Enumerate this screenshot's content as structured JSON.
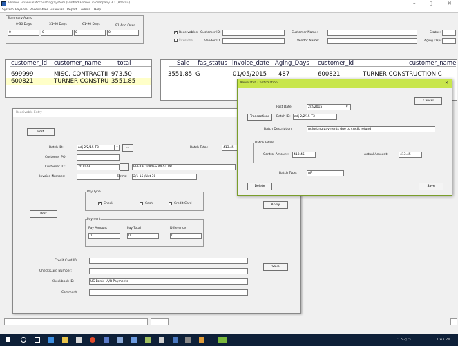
{
  "window": {
    "title": "Elinbox Financial Accounting System (Elinbad Entries in company 3.1 (Azerdi))",
    "minimize_label": "–",
    "maximize_label": "▯",
    "close_label": "✕"
  },
  "menu": [
    "System",
    "Payable",
    "Receivables",
    "Financial",
    "Report",
    "Admin",
    "Help"
  ],
  "summary_aging": {
    "title": "Summary Aging",
    "buckets": [
      "0-30 Days",
      "31-60 Days",
      "61-90 Days",
      "91 And Over"
    ],
    "values": [
      "0",
      "0",
      "0",
      "0"
    ]
  },
  "filters": {
    "receivables_label": "Receivables",
    "payables_label": "Payables",
    "receivables_checked": "✓",
    "customer_id_label": "Customer ID:",
    "vendor_id_label": "Vendor ID:",
    "customer_name_label": "Customer Name:",
    "vendor_name_label": "Vendor Name:",
    "status_label": "Status:",
    "aging_days_label": "Aging Days:"
  },
  "customer_grid": {
    "headers": [
      "customer_id",
      "customer_name",
      "total"
    ],
    "rows": [
      [
        "699999",
        "MISC. CONTRACTII",
        "973.50"
      ],
      [
        "600821",
        "TURNER CONSTRU",
        "3551.85"
      ]
    ]
  },
  "invoice_grid": {
    "headers": [
      "Sale",
      "fas_status",
      "invoice_date",
      "Aging_Days",
      "customer_id",
      "customer_name"
    ],
    "rows": [
      [
        "3551.85",
        "G",
        "01/05/2015",
        "487",
        "600821",
        "TURNER CONSTRUCTION C"
      ]
    ]
  },
  "receivable_entry": {
    "title": "Receivable Entry",
    "post_label": "Post",
    "batch_id_label": "Batch ID:",
    "batch_id_value": "adj 2/2/15 T3",
    "batch_id_more": "...",
    "batch_total_label": "Batch Total:",
    "batch_total_value": "413.45",
    "customer_po_label": "Customer PO:",
    "customer_id_label": "Customer ID:",
    "customer_id_value": "207173",
    "customer_id_more": "...",
    "customer_name_value": "REFRACTORIES WEST INC",
    "invoice_number_label": "Invoice Number:",
    "terms_label": "Terms:",
    "terms_value": "2/1 15 /Net 30",
    "pay_type_title": "Pay Type",
    "pay_check_label": "Check",
    "pay_check_mark": "✓",
    "pay_cash_label": "Cash",
    "pay_credit_label": "Credit Card",
    "payment_title": "Payment",
    "pay_amount_label": "Pay Amount",
    "pay_total_label": "Pay Total",
    "difference_label": "Difference",
    "pay_amount_value": "0",
    "pay_total_value": "0",
    "difference_value": "0",
    "post2_label": "Post",
    "apply_label": "Apply",
    "save_label": "Save",
    "credit_card_label": "Credit Card ID:",
    "check_card_label": "Check/Card Number:",
    "checkbook_label": "Checkbook ID:",
    "checkbook_value": "US Bank - A/R Payments",
    "comment_label": "Comment:"
  },
  "batch_confirmation": {
    "title": "New Batch Confirmation",
    "close_label": "✕",
    "cancel_label": "Cancel",
    "post_date_label": "Post Date:",
    "post_date_value": "2/2/2015",
    "transactions_label": "Transactions",
    "batch_id_label": "Batch ID:",
    "batch_id_value": "adj 2/2/15 T3",
    "batch_desc_label": "Batch Description:",
    "batch_desc_value": "Adjusting payments due to credit refund",
    "batch_totals_title": "Batch Totals",
    "control_amount_label": "Control Amount:",
    "control_amount_value": "413.45",
    "actual_amount_label": "Actual Amount:",
    "actual_amount_value": "413.45",
    "batch_type_label": "Batch Type:",
    "batch_type_value": "AR",
    "delete_label": "Delete",
    "save_label": "Save"
  },
  "taskbar": {
    "time": "1:43 PM",
    "tray": "^ ⌂ ◁ ▭"
  },
  "colors": {
    "highlight_row": "#ffffc8",
    "dialog_title": "#c8e64c",
    "taskbar": "#0e2038"
  }
}
